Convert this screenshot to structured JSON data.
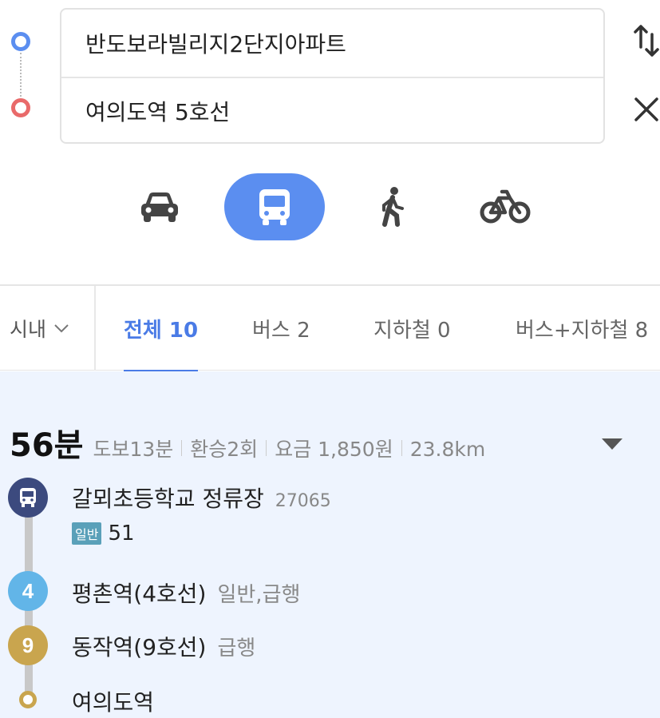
{
  "search": {
    "origin": "반도보라빌리지2단지아파트",
    "destination": "여의도역 5호선",
    "swap_icon": "swap-vertical-icon",
    "clear_icon": "close-icon"
  },
  "modes": {
    "items": [
      "car",
      "bus",
      "walk",
      "bicycle"
    ],
    "selected": "bus",
    "selected_color": "#5b8ef0"
  },
  "tabs": {
    "area": "시내",
    "items": [
      {
        "label": "전체 10",
        "active": true
      },
      {
        "label": "버스 2",
        "active": false
      },
      {
        "label": "지하철 0",
        "active": false
      },
      {
        "label": "버스+지하철 8",
        "active": false
      }
    ],
    "active_color": "#4a7be6"
  },
  "result": {
    "duration": "56분",
    "walk": "도보13분",
    "transfers": "환승2회",
    "fare": "요금 1,850원",
    "distance": "23.8km",
    "steps": [
      {
        "name": "갈뫼초등학교 정류장",
        "sub": "27065",
        "icon": "bus-icon",
        "color": "#3c4a7e"
      },
      {
        "name": "평촌역(4호선)",
        "sub": "일반,급행",
        "icon_label": "4",
        "color": "#62b5e8"
      },
      {
        "name": "동작역(9호선)",
        "sub": "급행",
        "icon_label": "9",
        "color": "#c9a54e"
      },
      {
        "name": "여의도역",
        "sub": "",
        "icon": "end-point",
        "color": "#c9a54e"
      }
    ],
    "bus": {
      "type": "일반",
      "number": "51",
      "badge_color": "#5aa0b9"
    },
    "background": "#eef4fe"
  }
}
